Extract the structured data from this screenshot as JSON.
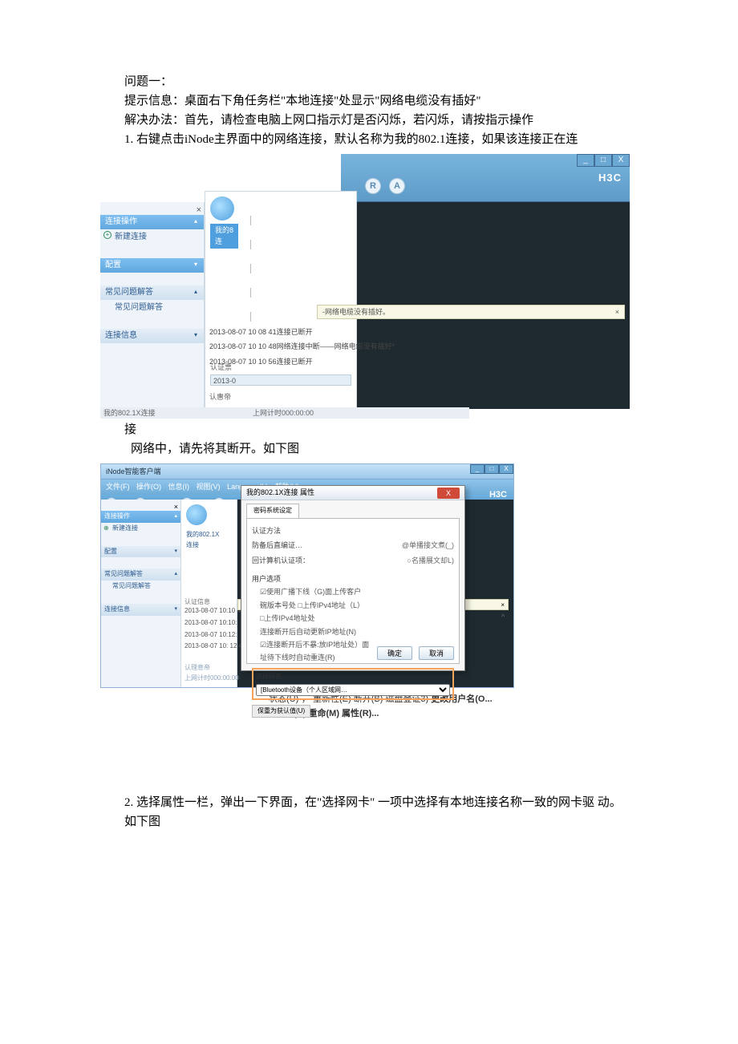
{
  "doc": {
    "q1": "问题一：",
    "hint": "提示信息：桌面右下角任务栏\"本地连接\"处显示\"网络电缆没有插好\"",
    "solve": "解决办法：首先，请检查电脑上网口指示灯是否闪烁，若闪烁，请按指示操作",
    "step1": "1.  右键点击iNode主界面中的网络连接，默认名称为我的802.1连接，如果该连接正在连",
    "step1b": "接",
    "step1c": "网络中，请先将其断开。如下图",
    "step2": "2.  选择属性一栏，弹出一下界面，在\"选择网卡\"  一项中选择有本地连接名称一致的网卡驱 动。如下图"
  },
  "s1": {
    "brand": "H3C",
    "winmin": "_",
    "winmax": "□",
    "wincls": "X",
    "circR": "R",
    "circA": "A",
    "side": {
      "close": "×",
      "h1": "连接操作",
      "newconn": "新建连接",
      "h2": "配置",
      "h3": "常见问题解答",
      "faq": "常见问题解答",
      "h4": "连接信息"
    },
    "mid": {
      "label1": "我的8",
      "label2": "连",
      "auth": "认证票",
      "date": "2013-0"
    },
    "tip": "-网络电缆没有插好。",
    "tipx": "×",
    "logs": [
      "2013-08-07 10    08  41连接已断开",
      "2013-08-07 10    10  48网络连接中断——网络电缆没有插好*",
      "2013-08-07 10    10  56连接已断开"
    ],
    "authexc": "认惠帝",
    "bottomL": "我的802.1X连接",
    "bottomR": "上网计时000:00:00"
  },
  "s2": {
    "title": "iNode智能客户端",
    "brand": "H3C",
    "menu": [
      "文件(F)",
      "操作(O)",
      "信息(I)",
      "视图(V)",
      "Language(L)",
      "帮助(H)"
    ],
    "side": {
      "close": "×",
      "h1": "连接操作",
      "newconn": "新建连接",
      "h2": "配置",
      "h3": "常见问题解答",
      "faq": "常见问题解答",
      "h4": "连接信息"
    },
    "mid": {
      "l1": "我的802.1X",
      "l2": "连接"
    },
    "auth2": "认证信息",
    "logs": [
      "2013-08-07 10:10   4",
      "2013-08-07 10:10:",
      "2013-08-07 10:12:",
      "2013-08-07 10:  12  4"
    ],
    "info1": "认理息帝",
    "info2": "上网计时000:00:00",
    "dialog": {
      "title": "我的802.1X连接 属性",
      "x": "X",
      "tab": "密码系统设定",
      "r1l": "认证方法",
      "r1v": "",
      "r2l": "防备后直编证…",
      "r2v": "",
      "r3l": "回计算机认证项：",
      "rb1": "@单播接文煮(_)",
      "rb2": "○名播展文却L)",
      "optHdr": "用户选项",
      "opts": [
        "☑使用广播下线（G)面上传客户",
        "碗版本号处 □上传IPv4地址（L）",
        "□上传IPv4地址处",
        "连接断开后自动更新IP地址(N)",
        "☑连接断开后不暴:放IP地址处）面",
        "址待下线时自动重连(R)"
      ],
      "selLabel": "选择网去",
      "selValue": "[Bluetooth设备（个人区域网…",
      "defaultBtn": "保重为获认值(U)",
      "ok": "确定",
      "cancel": "取消"
    },
    "tipx": "×",
    "tipa": "^"
  },
  "ctx": {
    "line1a": "状态(U)·，    重新性(E) 断开(B) 磁盘登证3) ",
    "line1b": "更改用户名(O...",
    "line2": "AM 删(D) 重命(M) 属性(R)..."
  }
}
